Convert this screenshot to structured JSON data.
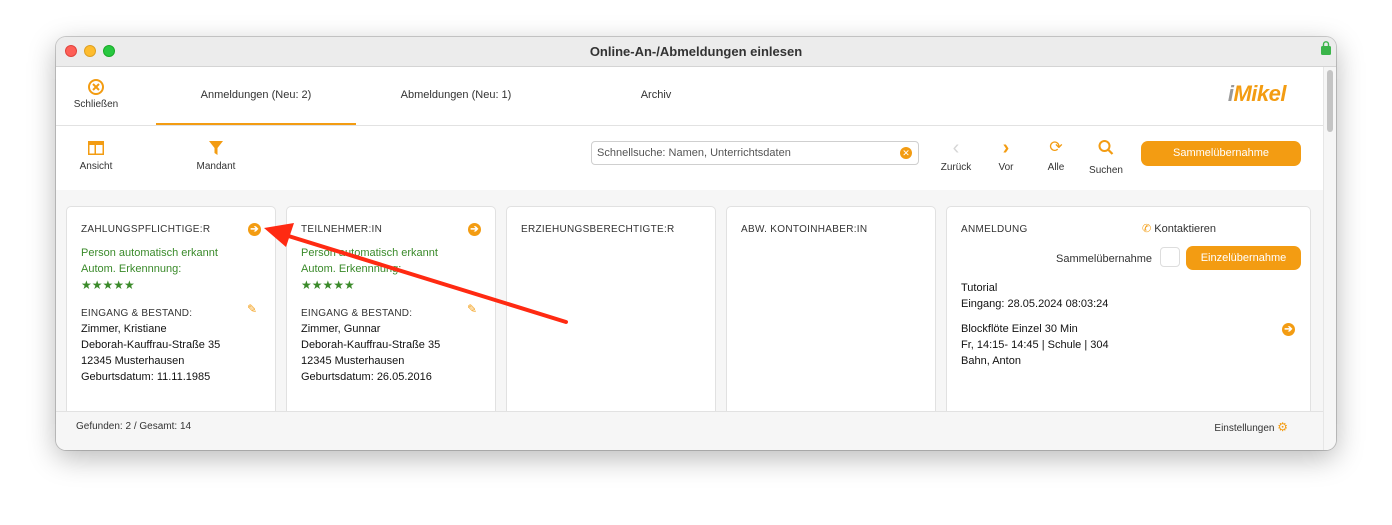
{
  "window": {
    "title": "Online-An-/Abmeldungen einlesen"
  },
  "toolbar": {
    "close_label": "Schließen",
    "tabs": [
      {
        "label": "Anmeldungen (Neu: 2)",
        "active": true
      },
      {
        "label": "Abmeldungen (Neu: 1)",
        "active": false
      },
      {
        "label": "Archiv",
        "active": false
      }
    ],
    "logo_i": "i",
    "logo_text": "Mikel"
  },
  "actions": {
    "view_label": "Ansicht",
    "client_label": "Mandant",
    "search_placeholder": "Schnellsuche: Namen, Unterrichtsdaten",
    "back_label": "Zurück",
    "forward_label": "Vor",
    "all_label": "Alle",
    "search_label": "Suchen",
    "bulk_button": "Sammelübernahme"
  },
  "cards": {
    "payer": {
      "header": "ZAHLUNGSPFLICHTIGE:R",
      "auto_detected": "Person automatisch erkannt",
      "auto_label": "Autom. Erkennnung:",
      "stars": "★★★★★",
      "section": "EINGANG & BESTAND:",
      "name": "Zimmer, Kristiane",
      "street": "Deborah-Kauffrau-Straße 35",
      "city": "12345 Musterhausen",
      "birth": "Geburtsdatum: 11.11.1985"
    },
    "participant": {
      "header": "TEILNEHMER:IN",
      "auto_detected": "Person automatisch erkannt",
      "auto_label": "Autom. Erkennnung:",
      "stars": "★★★★★",
      "section": "EINGANG & BESTAND:",
      "name": "Zimmer, Gunnar",
      "street": "Deborah-Kauffrau-Straße 35",
      "city": "12345 Musterhausen",
      "birth": "Geburtsdatum: 26.05.2016"
    },
    "guardian": {
      "header": "ERZIEHUNGSBERECHTIGTE:R"
    },
    "account_holder": {
      "header": "ABW. KONTOINHABER:IN"
    },
    "registration": {
      "header": "ANMELDUNG",
      "contact": "Kontaktieren",
      "bulk_label": "Sammelübernahme",
      "single_button": "Einzelübernahme",
      "type": "Tutorial",
      "received": "Eingang: 28.05.2024 08:03:24",
      "course": "Blockflöte Einzel 30 Min",
      "schedule": "Fr, 14:15- 14:45 | Schule | 304",
      "teacher": "Bahn, Anton"
    }
  },
  "status": {
    "found": "Gefunden: 2 / Gesamt: 14",
    "settings": "Einstellungen"
  },
  "colors": {
    "accent": "#f39c12",
    "green": "#3a8a2a",
    "annotation": "#ff2a12"
  }
}
